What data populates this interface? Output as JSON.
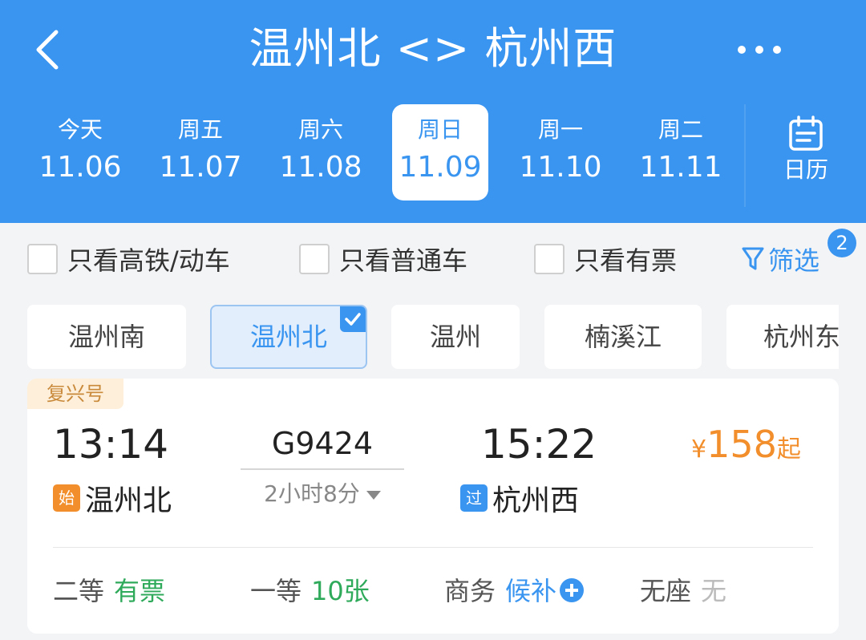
{
  "header": {
    "title": "温州北 <> 杭州西",
    "back_icon": "chevron-left-icon",
    "more_icon": "more-horizontal-icon",
    "background_color": "#3a95f0"
  },
  "dates": [
    {
      "dow": "今天",
      "md": "11.06",
      "selected": false
    },
    {
      "dow": "周五",
      "md": "11.07",
      "selected": false
    },
    {
      "dow": "周六",
      "md": "11.08",
      "selected": false
    },
    {
      "dow": "周日",
      "md": "11.09",
      "selected": true
    },
    {
      "dow": "周一",
      "md": "11.10",
      "selected": false
    },
    {
      "dow": "周二",
      "md": "11.11",
      "selected": false
    }
  ],
  "calendar": {
    "label": "日历",
    "icon": "calendar-icon"
  },
  "filters": {
    "gaotie": {
      "label": "只看高铁/动车",
      "checked": false
    },
    "putong": {
      "label": "只看普通车",
      "checked": false
    },
    "youpiao": {
      "label": "只看有票",
      "checked": false
    },
    "screen": {
      "label": "筛选",
      "badge": "2",
      "icon": "filter-icon"
    }
  },
  "stations": [
    {
      "label": "温州南",
      "selected": false
    },
    {
      "label": "温州北",
      "selected": true
    },
    {
      "label": "温州",
      "selected": false
    },
    {
      "label": "楠溪江",
      "selected": false
    },
    {
      "label": "杭州东",
      "selected": false
    }
  ],
  "train": {
    "brand": "复兴号",
    "departure_time": "13:14",
    "departure_tag": "始",
    "departure_station": "温州北",
    "train_number": "G9424",
    "duration": "2小时8分",
    "arrival_time": "15:22",
    "arrival_tag": "过",
    "arrival_station": "杭州西",
    "price_currency": "¥",
    "price": "158",
    "price_suffix": "起",
    "seats": [
      {
        "name": "二等",
        "value": "有票"
      },
      {
        "name": "一等",
        "value": "10张"
      },
      {
        "name": "商务",
        "value": "候补"
      },
      {
        "name": "无座",
        "value": "无"
      }
    ]
  },
  "colors": {
    "accent": "#3a95f0",
    "price": "#f28e2b",
    "available": "#2faa5b",
    "unavailable": "#bbbbbb"
  }
}
